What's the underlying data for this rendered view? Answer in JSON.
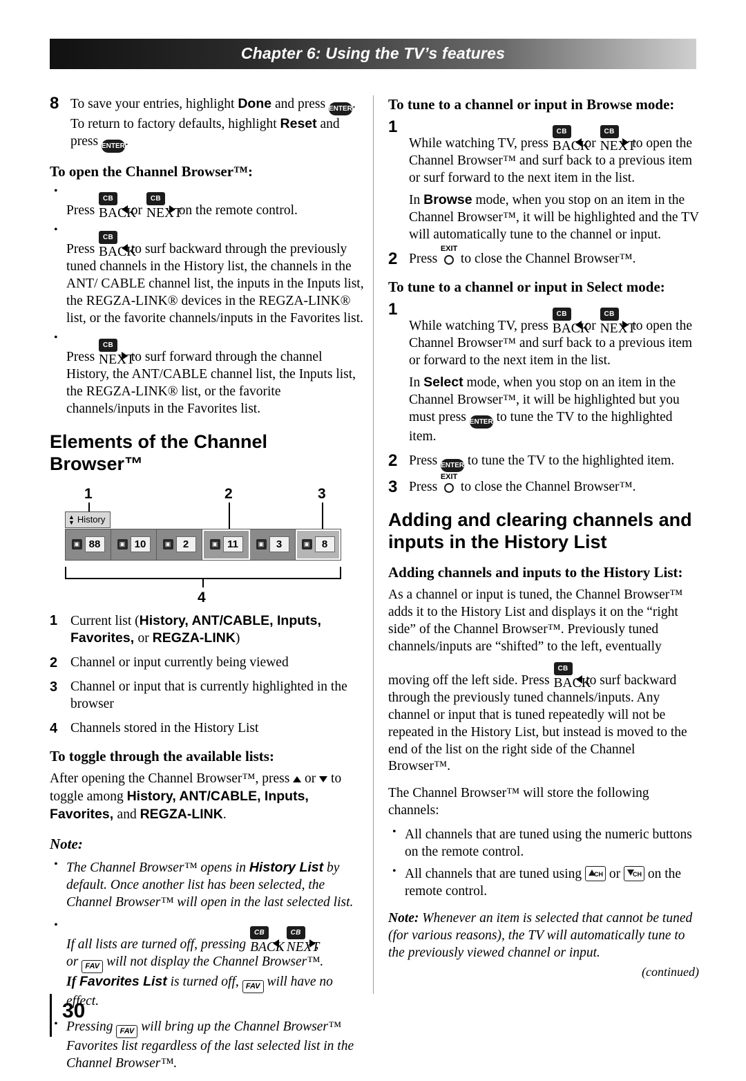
{
  "header": {
    "chapter_title": "Chapter 6: Using the TV’s features"
  },
  "left": {
    "step8": {
      "num": "8",
      "text_a": "To save your entries, highlight ",
      "done": "Done",
      "text_b": " and press ",
      "enter1": "ENTER",
      "text_c": ". To return to factory defaults, highlight ",
      "reset": "Reset",
      "text_d": " and press ",
      "enter2": "ENTER",
      "text_e": "."
    },
    "open_browser_heading": "To open the Channel Browser™:",
    "bullets": [
      {
        "pre": "Press ",
        "back_cap": "BACK",
        "cb": "CB",
        "mid": " or ",
        "next_cap": "NEXT",
        "cb2": "CB",
        "post": " on the remote control."
      },
      {
        "pre": "Press ",
        "cap": "BACK",
        "cb": "CB",
        "post": " to surf backward through the previously tuned channels in the History list, the channels in the ANT/ CABLE channel list, the inputs in the Inputs list, the REGZA-LINK® devices in the REGZA-LINK® list, or the favorite channels/inputs in the Favorites list."
      },
      {
        "pre": "Press ",
        "cap": "NEXT",
        "cb": "CB",
        "post": " to surf forward through the channel History, the ANT/CABLE channel list, the Inputs list, the REGZA-LINK® list, or the favorite channels/inputs in the Favorites list."
      }
    ],
    "elements_heading": "Elements of the Channel Browser™",
    "figure": {
      "callouts": [
        "1",
        "2",
        "3",
        "4"
      ],
      "history_label": "History",
      "cells": [
        {
          "num": "88",
          "state": "normal"
        },
        {
          "num": "10",
          "state": "normal"
        },
        {
          "num": "2",
          "state": "normal"
        },
        {
          "num": "11",
          "state": "current"
        },
        {
          "num": "3",
          "state": "normal"
        },
        {
          "num": "8",
          "state": "highlighted"
        }
      ]
    },
    "legend": [
      {
        "num": "1",
        "pre": "Current list (",
        "items": "History, ANT/CABLE, Inputs, Favorites, ",
        "or": "or ",
        "last": "REGZA-LINK",
        "post": ")"
      },
      {
        "num": "2",
        "text": "Channel or input currently being viewed"
      },
      {
        "num": "3",
        "text": "Channel or input that is currently highlighted in the browser"
      },
      {
        "num": "4",
        "text": "Channels stored in the History List"
      }
    ],
    "toggle_heading": "To toggle through the available lists:",
    "toggle_text_a": "After opening the Channel Browser™, press ",
    "toggle_text_b": " or ",
    "toggle_text_c": " to toggle among ",
    "toggle_lists_1": "History, ANT/CABLE, Inputs, Favorites, ",
    "toggle_and": "and ",
    "toggle_lists_2": "REGZA-LINK",
    "toggle_period": ".",
    "note_heading": "Note:",
    "notes": [
      {
        "segs": [
          {
            "t": "The Channel Browser™ opens in ",
            "b": false
          },
          {
            "t": "History List",
            "b": true
          },
          {
            "t": " by default. Once another list has been selected, the Channel Browser™ will open in the last selected list.",
            "b": false
          }
        ]
      },
      {
        "pre": "If all lists are turned off, pressing ",
        "back_cap": "BACK",
        "next_cap": "NEXT",
        "cb": "CB",
        "mid": ", ",
        "or": "or ",
        "fav": "FAV",
        "post": " will not display the Channel Browser™.",
        "line2_pre": "If ",
        "line2_bold": "Favorites List",
        "line2_mid": " is turned off, ",
        "line2_fav": "FAV",
        "line2_post": " will have no effect."
      },
      {
        "pre": "Pressing ",
        "fav": "FAV",
        "post": " will bring up the Channel Browser™ Favorites list regardless of the last selected list in the Channel Browser™."
      }
    ]
  },
  "right": {
    "browse_heading": "To tune to a channel or input in Browse mode:",
    "browse_steps": [
      {
        "num": "1",
        "pre": "While watching TV, press ",
        "back_cap": "BACK",
        "cb": "CB",
        "mid": " or ",
        "next_cap": "NEXT",
        "post": " to open the Channel Browser™ and surf back to a previous item or surf forward to the next item in the list.",
        "para2_pre": "In ",
        "para2_bold": "Browse",
        "para2_post": " mode, when you stop on an item in the Channel Browser™, it will be highlighted and the TV will automatically tune to the channel or input."
      },
      {
        "num": "2",
        "pre": "Press ",
        "exit": "EXIT",
        "post": " to close the Channel Browser™."
      }
    ],
    "select_heading": "To tune to a channel or input in Select mode:",
    "select_steps": [
      {
        "num": "1",
        "pre": "While watching TV, press ",
        "back_cap": "BACK",
        "cb": "CB",
        "mid": " or ",
        "next_cap": "NEXT",
        "post": " to open the Channel Browser™ and surf back to a previous item or forward to the next item in the list.",
        "para2_pre": "In ",
        "para2_bold": "Select",
        "para2_mid": " mode, when you stop on an item in the Channel Browser™, it will be highlighted but you must press ",
        "enter": "ENTER",
        "para2_post": " to tune the TV to the highlighted item."
      },
      {
        "num": "2",
        "pre": "Press ",
        "enter": "ENTER",
        "post": " to tune the TV to the highlighted item."
      },
      {
        "num": "3",
        "pre": "Press ",
        "exit": "EXIT",
        "post": " to close the Channel Browser™."
      }
    ],
    "adding_heading": "Adding and clearing channels and inputs in the History List",
    "adding_sub": "Adding channels and inputs to the History List:",
    "adding_p1_a": "As a channel or input is tuned, the Channel Browser™ adds it to the History List and displays it on the “right side” of the Channel Browser™. Previously tuned channels/inputs are “shifted” to the left, eventually moving off the left side. Press ",
    "adding_p1_cap": "BACK",
    "adding_p1_cb": "CB",
    "adding_p1_b": " to surf backward through the previously tuned channels/inputs. Any channel or input that is tuned repeatedly will not be repeated in the History List, but instead is moved to the end of the list on the right side of the Channel Browser™.",
    "adding_p2": "The Channel Browser™ will store the following channels:",
    "adding_bullets": [
      {
        "text": "All channels that are tuned using the numeric buttons on the remote control."
      },
      {
        "pre": "All channels that are tuned using ",
        "ch_up": "CH",
        "mid": " or ",
        "ch_dn": "CH",
        "post": " on the remote control."
      }
    ],
    "note_bold": "Note:",
    "note_text": " Whenever an item is selected that cannot be tuned (for various reasons), the TV will automatically tune to the previously viewed channel or input."
  },
  "footer": {
    "page_number": "30",
    "continued": "(continued)"
  }
}
